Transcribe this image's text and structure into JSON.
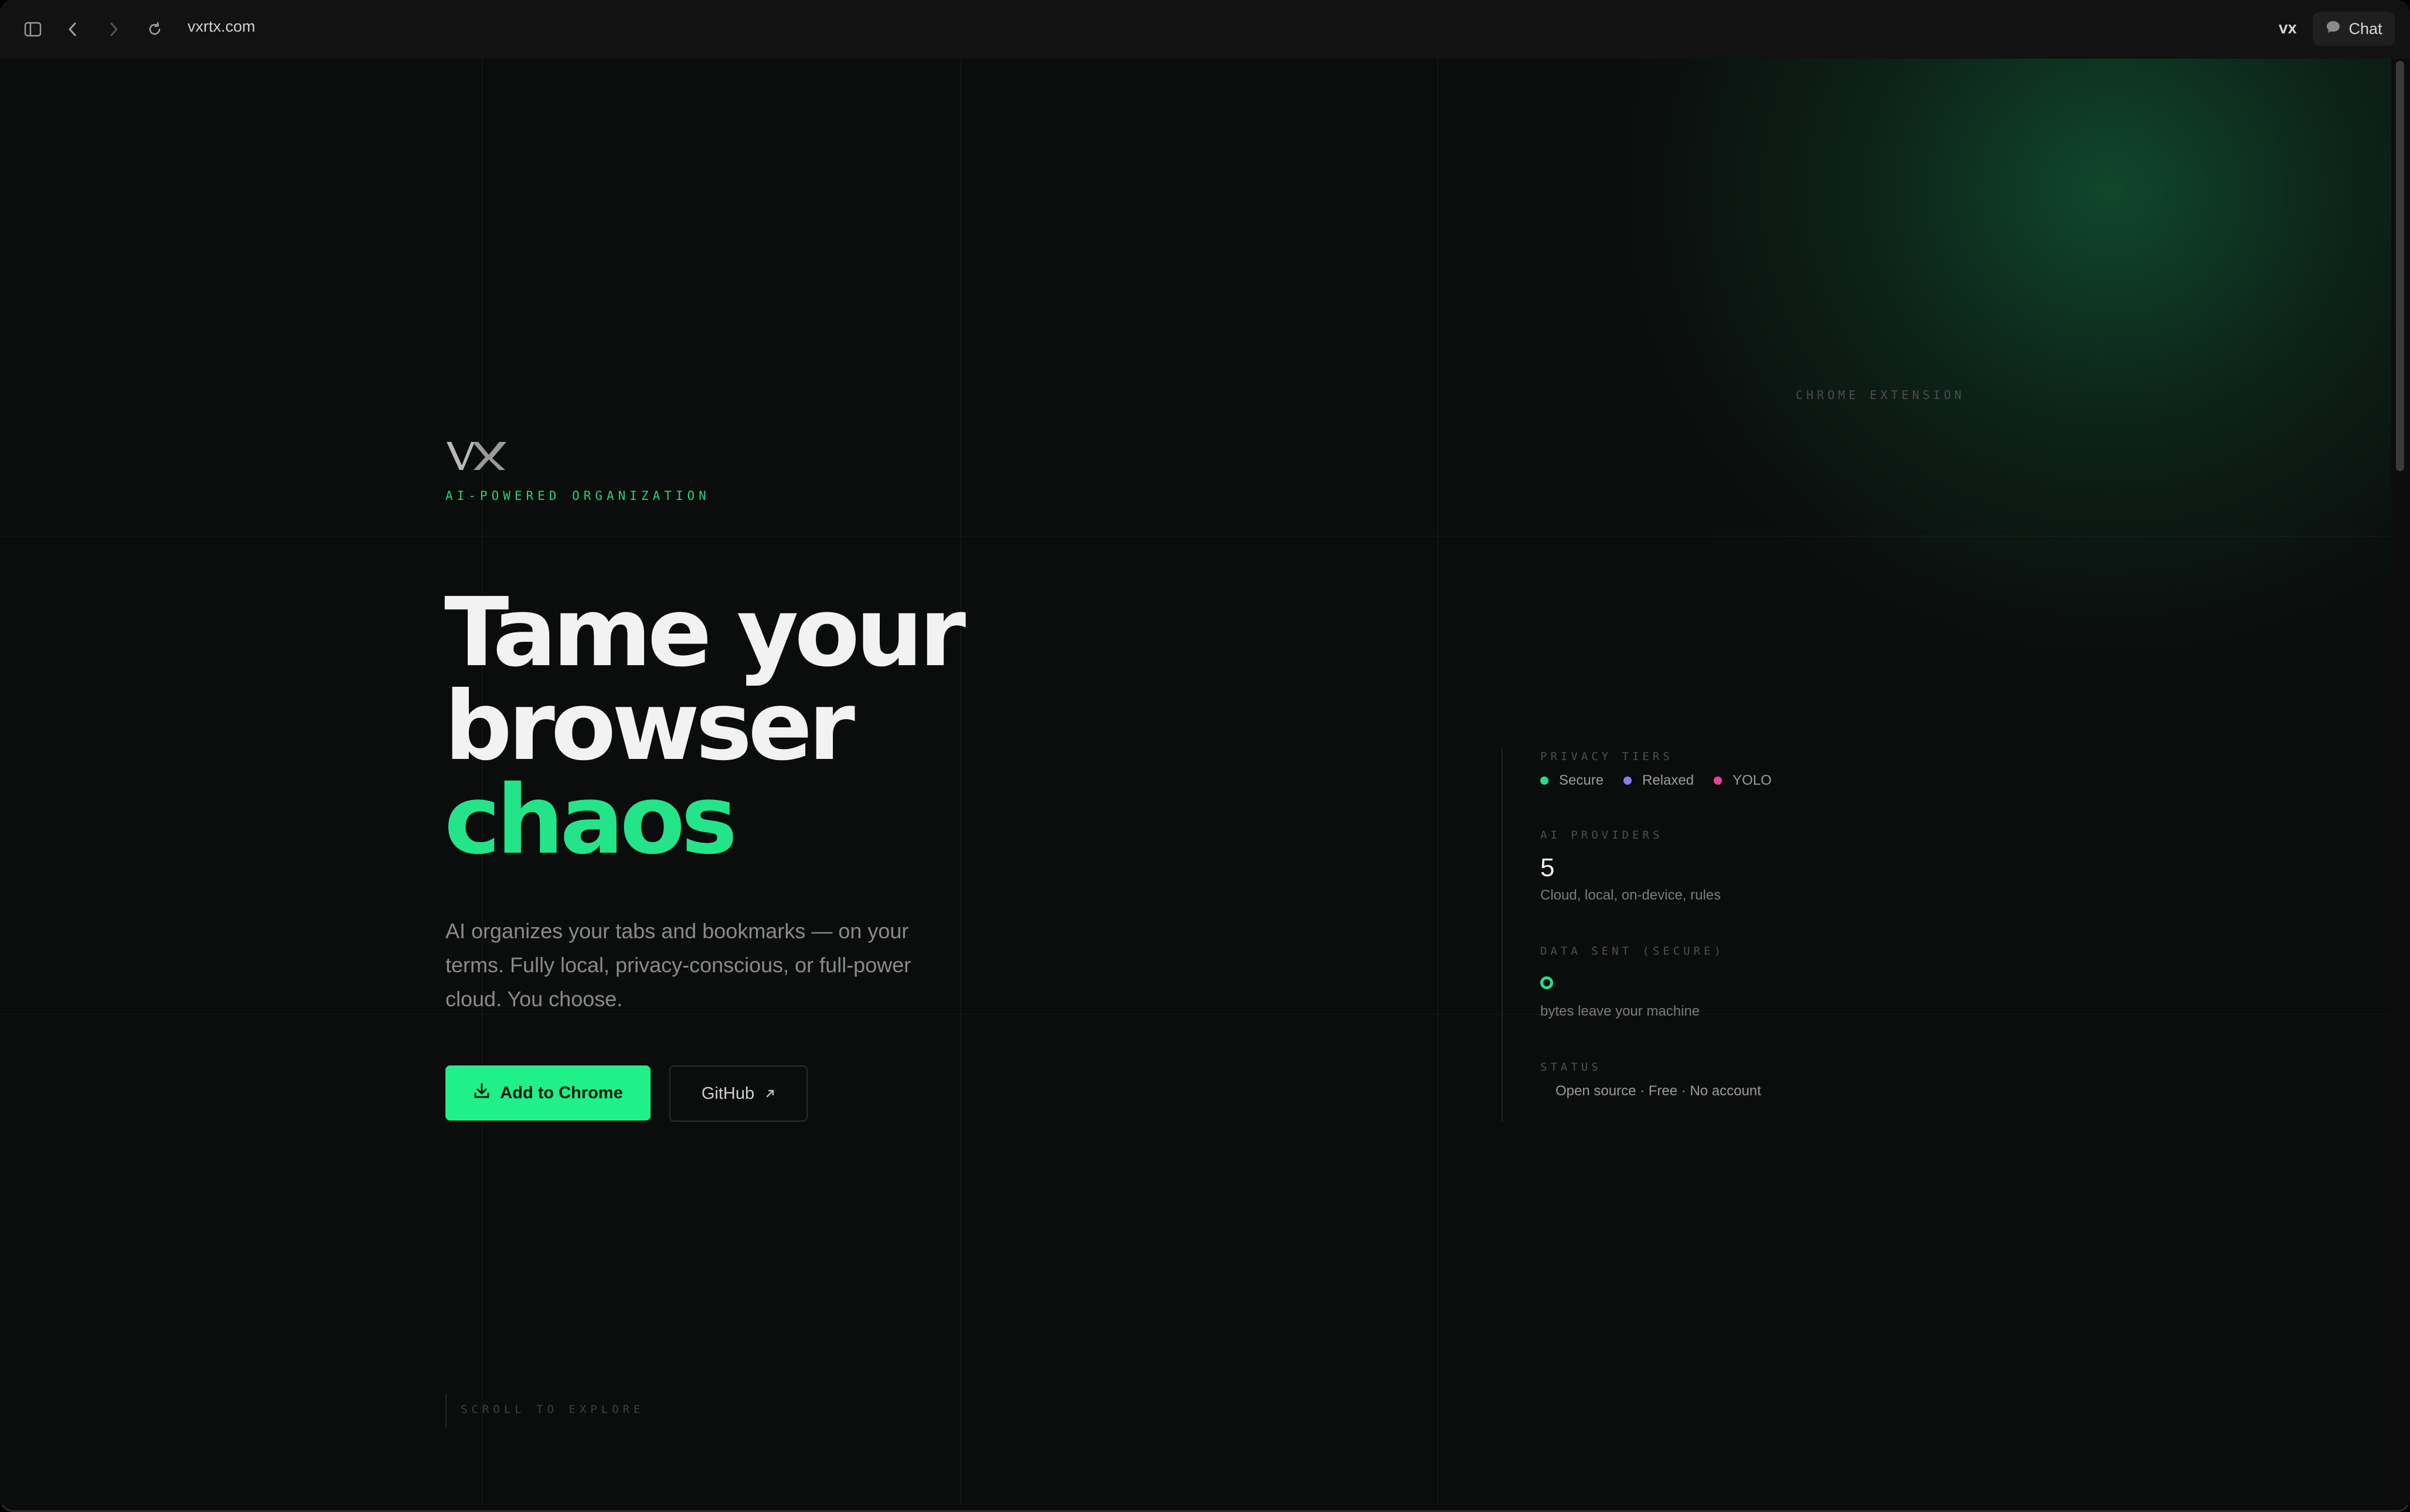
{
  "browser": {
    "url": "vxrtx.com",
    "chat_label": "Chat",
    "icons": [
      "sidebar-toggle-icon",
      "back-arrow-icon",
      "forward-arrow-icon",
      "reload-icon",
      "extension-icon",
      "chat-bubble-icon"
    ]
  },
  "hero": {
    "brand_logo": "VX",
    "tag": "CHROME EXTENSION",
    "eyebrow": "AI-POWERED ORGANIZATION",
    "headline_line1": "Tame your",
    "headline_line2": "browser",
    "headline_accent": "chaos",
    "description": "AI organizes your tabs and bookmarks — on your terms. Fully local, privacy-conscious, or full-power cloud. You choose.",
    "primary_button": "Add to Chrome",
    "secondary_button": "GitHub",
    "accent_color": "#1ff088"
  },
  "stats": {
    "privacy_label": "PRIVACY TIERS",
    "tiers": [
      {
        "name": "Secure",
        "color": "#22e08a"
      },
      {
        "name": "Relaxed",
        "color": "#8a7cf0"
      },
      {
        "name": "YOLO",
        "color": "#f0409a"
      }
    ],
    "providers_label": "AI PROVIDERS",
    "providers_value": "5",
    "providers_desc": "Cloud, local, on-device, rules",
    "data_label": "DATA SENT (SECURE)",
    "data_desc": "bytes leave your machine",
    "status_label": "STATUS",
    "status_value": "Open source · Free · No account"
  },
  "scroll_hint": "SCROLL TO EXPLORE"
}
